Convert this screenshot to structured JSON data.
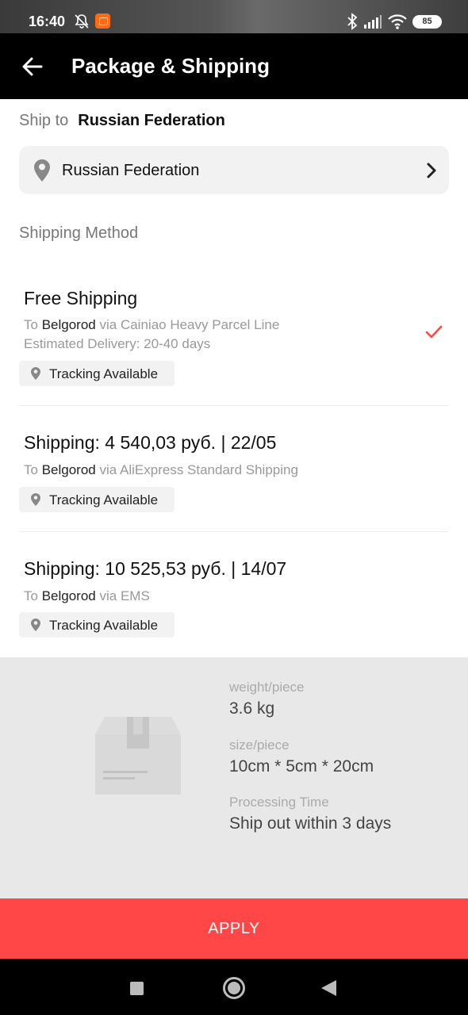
{
  "status_bar": {
    "time": "16:40",
    "battery": "85",
    "icons": [
      "bell-off-icon",
      "app-notification-icon",
      "bluetooth-icon",
      "cellular-signal-icon",
      "wifi-icon",
      "battery-icon"
    ]
  },
  "header": {
    "title": "Package & Shipping",
    "back_icon": "arrow-left-icon"
  },
  "ship_to": {
    "label": "Ship to",
    "value": "Russian Federation"
  },
  "address_selector": {
    "value": "Russian Federation",
    "icon": "location-pin-icon",
    "chevron": "chevron-right-icon"
  },
  "shipping_method": {
    "title": "Shipping Method",
    "options": [
      {
        "title": "Free Shipping",
        "to": "To",
        "city": "Belgorod",
        "via": "via Cainiao Heavy Parcel Line",
        "estimate": "Estimated Delivery: 20-40 days",
        "tag": "Tracking Available",
        "selected": true
      },
      {
        "title": "Shipping: 4 540,03 руб. | 22/05",
        "to": "To",
        "city": "Belgorod",
        "via": "via AliExpress Standard Shipping",
        "tag": "Tracking Available",
        "selected": false
      },
      {
        "title": "Shipping: 10 525,53 руб. | 14/07",
        "to": "To",
        "city": "Belgorod",
        "via": "via EMS",
        "tag": "Tracking Available",
        "selected": false
      }
    ]
  },
  "package_info": {
    "weight_label": "weight/piece",
    "weight_value": "3.6 kg",
    "size_label": "size/piece",
    "size_value": "10cm * 5cm * 20cm",
    "processing_label": "Processing Time",
    "processing_value": "Ship out within 3 days"
  },
  "apply_button": "APPLY",
  "colors": {
    "accent": "#ff4747",
    "check": "#ff4747",
    "header_bg": "#000000",
    "panel_bg": "#e8e8e8"
  },
  "nav_bar": {
    "icons": [
      "recents-square-icon",
      "home-circle-icon",
      "back-triangle-icon"
    ]
  }
}
